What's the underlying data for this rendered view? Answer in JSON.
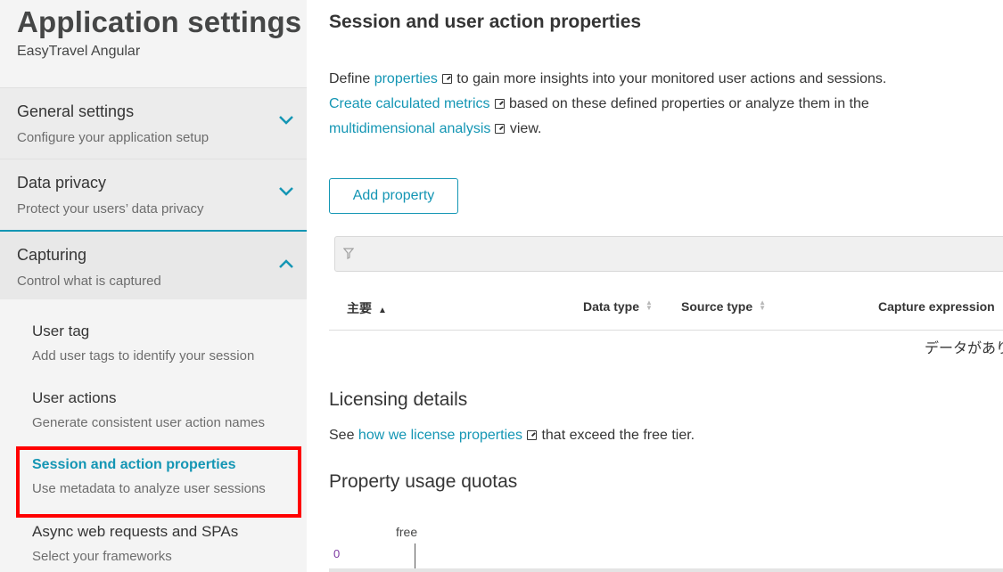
{
  "sidebar": {
    "app_title": "Application settings",
    "app_subtitle": "EasyTravel Angular",
    "sections": [
      {
        "title": "General settings",
        "desc": "Configure your application setup",
        "expanded": false
      },
      {
        "title": "Data privacy",
        "desc": "Protect your users’ data privacy",
        "expanded": false
      },
      {
        "title": "Capturing",
        "desc": "Control what is captured",
        "expanded": true
      }
    ],
    "sub_items": [
      {
        "title": "User tag",
        "desc": "Add user tags to identify your session"
      },
      {
        "title": "User actions",
        "desc": "Generate consistent user action names"
      },
      {
        "title": "Session and action properties",
        "desc": "Use metadata to analyze user sessions",
        "active": true
      },
      {
        "title": "Async web requests and SPAs",
        "desc": "Select your frameworks"
      }
    ]
  },
  "main": {
    "title": "Session and user action properties",
    "intro": {
      "l1_before": "Define ",
      "l1_link": "properties",
      "l1_after": " to gain more insights into your monitored user actions and sessions.",
      "l2_link": "Create calculated metrics",
      "l2_after": " based on these defined properties or analyze them in the",
      "l3_link": "multidimensional analysis",
      "l3_after": " view."
    },
    "add_button": "Add property",
    "table": {
      "headers": {
        "key": "主要",
        "data_type": "Data type",
        "source_type": "Source type",
        "capture_expression": "Capture expression"
      },
      "no_data": "データがあり"
    },
    "licensing": {
      "title": "Licensing details",
      "text_before": "See ",
      "link": "how we license properties",
      "text_after": " that exceed the free tier."
    },
    "quotas": {
      "title": "Property usage quotas",
      "series_label": "free",
      "axis_zero": "0"
    }
  },
  "colors": {
    "accent": "#1496b4",
    "highlight": "#ff0000",
    "sidebar_bg": "#f4f4f4"
  }
}
